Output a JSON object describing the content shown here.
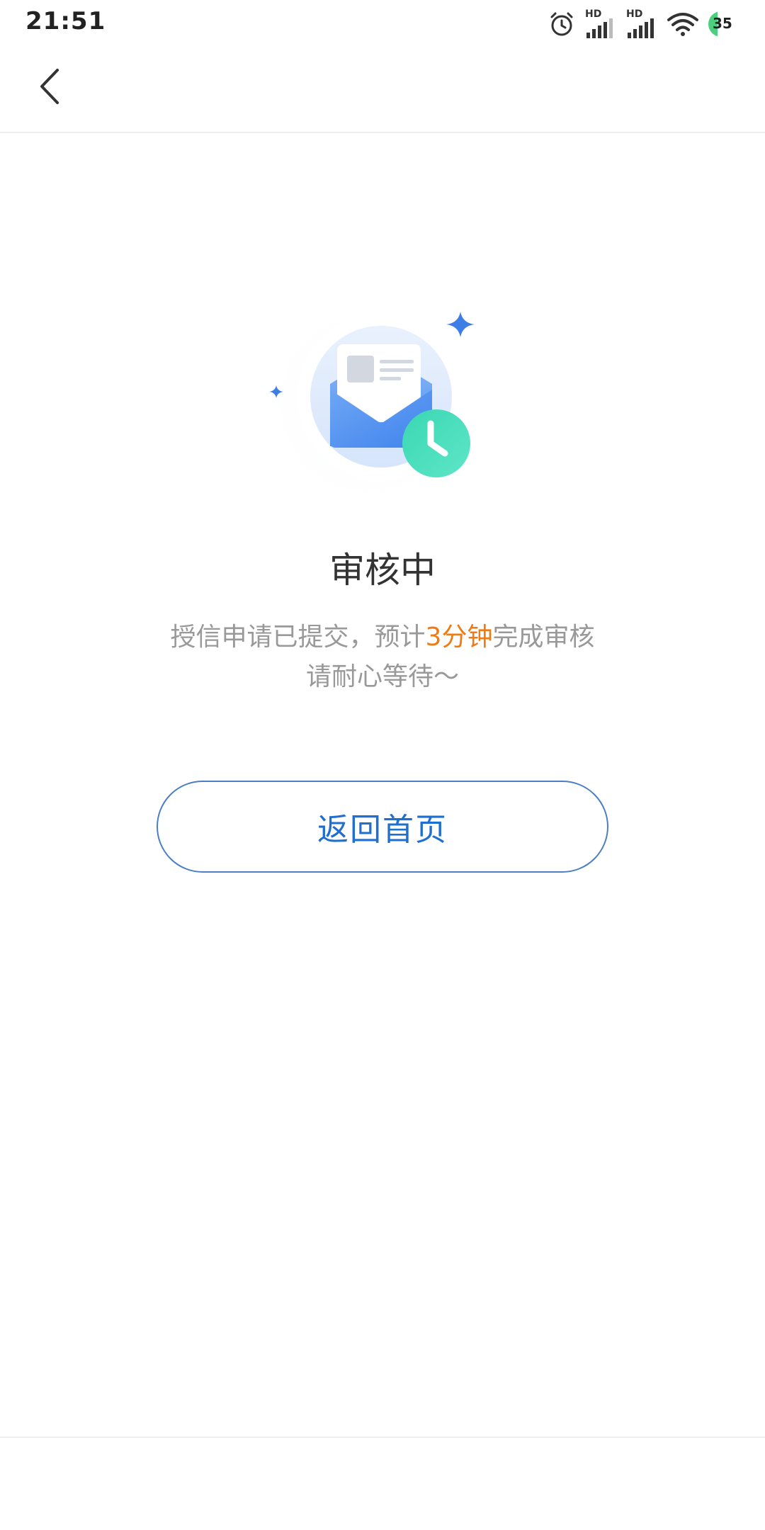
{
  "status_bar": {
    "time": "21:51",
    "signal_1_label": "HD",
    "signal_2_label": "HD",
    "battery_level": "35",
    "battery_color": "#4cd07d",
    "icons": [
      "alarm-icon",
      "signal-icon",
      "signal-icon",
      "wifi-icon",
      "battery-icon"
    ]
  },
  "nav": {
    "back_icon": "chevron-left-icon"
  },
  "illustration": {
    "icons": [
      "envelope-icon",
      "clock-icon",
      "sparkle-icon"
    ],
    "accent_color": "#3d7ee6",
    "clock_color": "#3fd9b6"
  },
  "main": {
    "title": "审核中",
    "desc_prefix": "授信申请已提交，预计",
    "desc_highlight": "3分钟",
    "desc_suffix": "完成审核",
    "desc_line2": "请耐心等待～",
    "highlight_color": "#f07b12"
  },
  "actions": {
    "home_button_label": "返回首页",
    "button_color": "#1f6fd1"
  }
}
